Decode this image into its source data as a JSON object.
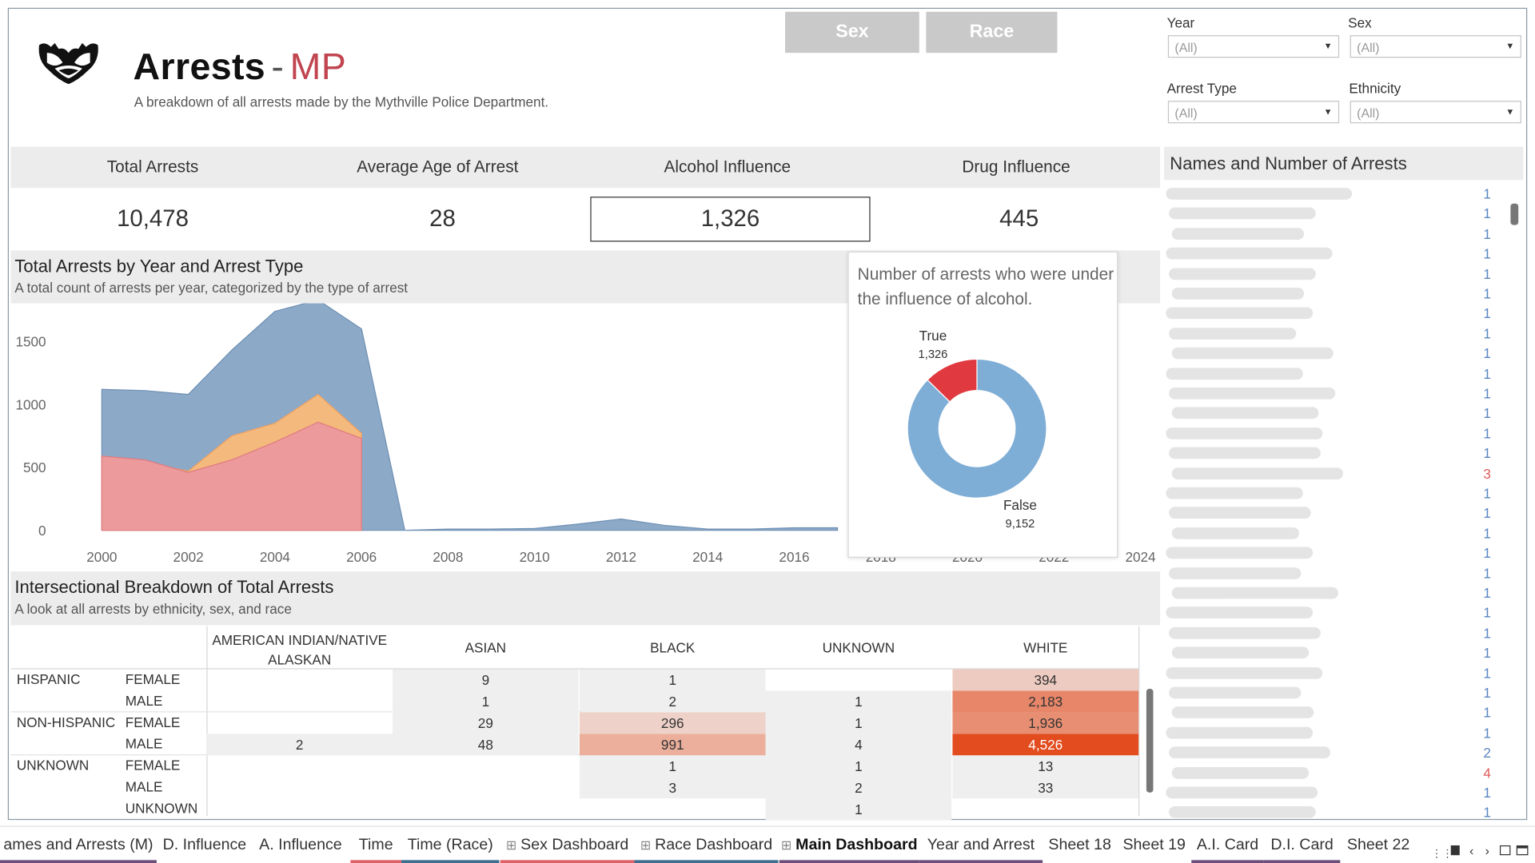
{
  "header": {
    "title": "Arrests",
    "title_dash": "-",
    "title_suffix": "MP",
    "subtitle": "A breakdown of all arrests made by the Mythville Police Department.",
    "logo_icon": "owl-logo-icon"
  },
  "toggle_buttons": [
    "Sex",
    "Race"
  ],
  "filters": [
    {
      "label": "Year",
      "value": "(All)"
    },
    {
      "label": "Sex",
      "value": "(All)"
    },
    {
      "label": "Arrest Type",
      "value": "(All)"
    },
    {
      "label": "Ethnicity",
      "value": "(All)"
    }
  ],
  "kpis": [
    {
      "label": "Total Arrests",
      "value": "10,478"
    },
    {
      "label": "Average Age of Arrest",
      "value": "28"
    },
    {
      "label": "Alcohol Influence",
      "value": "1,326"
    },
    {
      "label": "Drug Influence",
      "value": "445"
    }
  ],
  "area_section": {
    "title": "Total Arrests by Year and Arrest Type",
    "subtitle": "A total count of arrests per year, categorized by the type of arrest"
  },
  "chart_data": [
    {
      "type": "area",
      "stacked": false,
      "x": [
        2000,
        2001,
        2002,
        2003,
        2004,
        2005,
        2006,
        2007,
        2008,
        2009,
        2010,
        2011,
        2012,
        2013,
        2014,
        2015,
        2016,
        2017
      ],
      "xlim": [
        1999.6,
        2024
      ],
      "x_ticks": [
        2000,
        2002,
        2004,
        2006,
        2008,
        2010,
        2012,
        2014,
        2016,
        2018,
        2020,
        2022,
        2024
      ],
      "ylim": [
        0,
        1850
      ],
      "y_ticks": [
        0,
        500,
        1000,
        1500
      ],
      "grid": false,
      "series": [
        {
          "values": [
            1120,
            1110,
            1080,
            1430,
            1740,
            1830,
            1600,
            0,
            10,
            10,
            15,
            50,
            90,
            40,
            10,
            10,
            20,
            20
          ],
          "color": "#8ca9c8"
        },
        {
          "values": [
            580,
            540,
            470,
            750,
            850,
            1080,
            770,
            0,
            0,
            0,
            0,
            0,
            0,
            0,
            0,
            0,
            0,
            0
          ],
          "color": "#f4b97c"
        },
        {
          "values": [
            590,
            560,
            460,
            560,
            700,
            860,
            730,
            0,
            0,
            0,
            0,
            0,
            5,
            0,
            0,
            0,
            0,
            0
          ],
          "color": "#ec9a9c"
        }
      ]
    },
    {
      "type": "pie",
      "donut": true,
      "title": "Number of arrests who were under the influence of alcohol.",
      "slices": [
        {
          "label": "True",
          "value": 1326,
          "color": "#e0393f"
        },
        {
          "label": "False",
          "value": 9152,
          "color": "#7eadd6"
        }
      ]
    }
  ],
  "tooltip": {
    "text": "Number of arrests who were under the influence of alcohol.",
    "true_label": "True",
    "true_value": "1,326",
    "false_label": "False",
    "false_value": "9,152"
  },
  "crosstab_section": {
    "title": "Intersectional Breakdown of Total Arrests",
    "subtitle": "A look at all arrests by ethnicity, sex, and race"
  },
  "crosstab": {
    "columns": [
      "AMERICAN INDIAN/NATIVE ALASKAN",
      "ASIAN",
      "BLACK",
      "UNKNOWN",
      "WHITE"
    ],
    "rows": [
      {
        "ethnicity": "HISPANIC",
        "sex": "FEMALE",
        "cells": [
          "",
          "9",
          "1",
          "",
          "394"
        ]
      },
      {
        "ethnicity": "",
        "sex": "MALE",
        "cells": [
          "",
          "1",
          "2",
          "1",
          "2,183"
        ]
      },
      {
        "ethnicity": "NON-HISPANIC",
        "sex": "FEMALE",
        "cells": [
          "",
          "29",
          "296",
          "1",
          "1,936"
        ]
      },
      {
        "ethnicity": "",
        "sex": "MALE",
        "cells": [
          "2",
          "48",
          "991",
          "4",
          "4,526"
        ]
      },
      {
        "ethnicity": "UNKNOWN",
        "sex": "FEMALE",
        "cells": [
          "",
          "",
          "1",
          "1",
          "13"
        ]
      },
      {
        "ethnicity": "",
        "sex": "MALE",
        "cells": [
          "",
          "",
          "3",
          "2",
          "33"
        ]
      },
      {
        "ethnicity": "",
        "sex": "UNKNOWN",
        "cells": [
          "",
          "",
          "",
          "1",
          ""
        ]
      }
    ]
  },
  "names_panel": {
    "title": "Names and Number of Arrests",
    "counts": [
      "1",
      "1",
      "1",
      "1",
      "1",
      "1",
      "1",
      "1",
      "1",
      "1",
      "1",
      "1",
      "1",
      "1",
      "3",
      "1",
      "1",
      "1",
      "1",
      "1",
      "1",
      "1",
      "1",
      "1",
      "1",
      "1",
      "1",
      "1",
      "2",
      "4",
      "1",
      "1"
    ]
  },
  "tabs": [
    {
      "label": "ames and Arrests (M)",
      "icon": "",
      "color": "#6b4f7a"
    },
    {
      "label": "D. Influence",
      "icon": "",
      "color": ""
    },
    {
      "label": "A. Influence",
      "icon": "",
      "color": ""
    },
    {
      "label": "Time",
      "icon": "",
      "color": "#e0616a"
    },
    {
      "label": "Time (Race)",
      "icon": "",
      "color": "#3e6f8e"
    },
    {
      "label": "Sex Dashboard",
      "icon": "⊞",
      "color": "#e0616a"
    },
    {
      "label": "Race Dashboard",
      "icon": "⊞",
      "color": "#3e6f8e"
    },
    {
      "label": "Main Dashboard",
      "icon": "⊞",
      "color": "#6b4f7a"
    },
    {
      "label": "Year and Arrest",
      "icon": "",
      "color": "#6b4f7a"
    },
    {
      "label": "Sheet 18",
      "icon": "",
      "color": ""
    },
    {
      "label": "Sheet 19",
      "icon": "",
      "color": ""
    },
    {
      "label": "A.I. Card",
      "icon": "",
      "color": "#6b4f7a"
    },
    {
      "label": "D.I. Card",
      "icon": "",
      "color": "#6b4f7a"
    },
    {
      "label": "Sheet 22",
      "icon": "",
      "color": ""
    }
  ],
  "tab_nav_icons": [
    "grid-view-icon",
    "sheet-icon",
    "prev-tab-icon",
    "next-tab-icon",
    "fit-icon",
    "present-icon"
  ]
}
